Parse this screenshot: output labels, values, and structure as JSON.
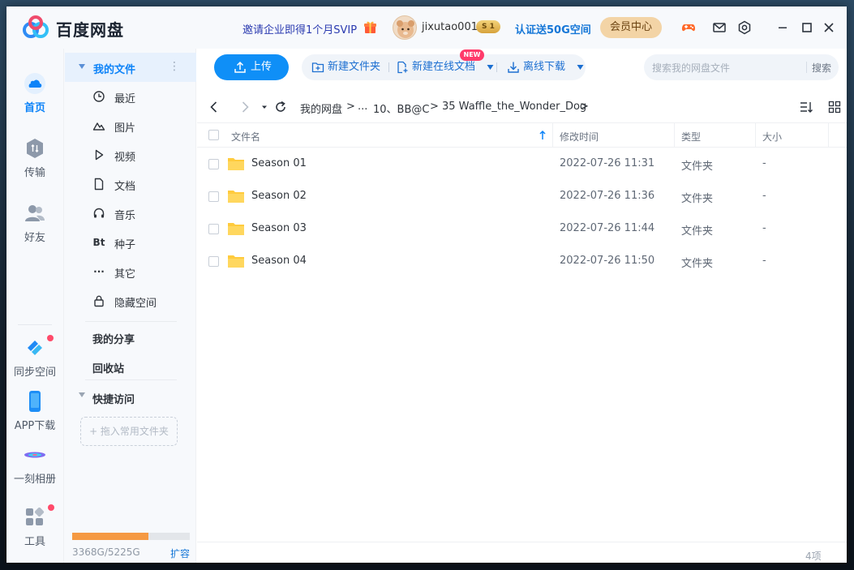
{
  "app": {
    "name": "百度网盘"
  },
  "titlebar": {
    "promo": "邀请企业即得1个月SVIP",
    "username": "jixutao001",
    "level_badge": "S 1",
    "verify": "认证送50G空间",
    "vip_center": "会员中心"
  },
  "leftnav": {
    "items": [
      {
        "label": "首页",
        "icon": "cloud-icon",
        "active": true
      },
      {
        "label": "传输",
        "icon": "transfer-icon"
      },
      {
        "label": "好友",
        "icon": "friends-icon"
      },
      {
        "label": "同步空间",
        "icon": "sync-space-icon"
      },
      {
        "label": "APP下载",
        "icon": "phone-icon"
      },
      {
        "label": "一刻相册",
        "icon": "album-icon"
      },
      {
        "label": "工具",
        "icon": "tools-icon"
      }
    ]
  },
  "sidepanel": {
    "my_files": "我的文件",
    "more": "⋮",
    "categories": [
      {
        "label": "最近",
        "icon": "clock-icon"
      },
      {
        "label": "图片",
        "icon": "image-icon"
      },
      {
        "label": "视频",
        "icon": "play-icon"
      },
      {
        "label": "文档",
        "icon": "document-icon"
      },
      {
        "label": "音乐",
        "icon": "headphones-icon"
      },
      {
        "label": "种子",
        "icon": "bt-icon",
        "glyph": "Bt"
      },
      {
        "label": "其它",
        "icon": "more-dots-icon",
        "glyph": "···"
      },
      {
        "label": "隐藏空间",
        "icon": "lock-icon"
      }
    ],
    "my_share": "我的分享",
    "recycle_bin": "回收站",
    "quick_access": "快捷访问",
    "drop_hint": "+ 拖入常用文件夹",
    "quota": {
      "text": "3368G/5225G",
      "used": 3368,
      "total": 5225
    },
    "expand": "扩容"
  },
  "toolbar": {
    "upload": "上传",
    "new_folder": "新建文件夹",
    "new_online_doc": "新建在线文档",
    "new_badge": "NEW",
    "offline_download": "离线下载",
    "search_placeholder": "搜索我的网盘文件",
    "search_button": "搜索"
  },
  "breadcrumb": {
    "items": [
      "我的网盘",
      "...",
      "10、BB@C",
      "35 Waffle_the_Wonder_Dog"
    ],
    "separator": ">"
  },
  "table": {
    "headers": {
      "name": "文件名",
      "modified": "修改时间",
      "type": "类型",
      "size": "大小"
    },
    "rows": [
      {
        "name": "Season 01",
        "modified": "2022-07-26 11:31",
        "type": "文件夹",
        "size": "-"
      },
      {
        "name": "Season 02",
        "modified": "2022-07-26 11:36",
        "type": "文件夹",
        "size": "-"
      },
      {
        "name": "Season 03",
        "modified": "2022-07-26 11:44",
        "type": "文件夹",
        "size": "-"
      },
      {
        "name": "Season 04",
        "modified": "2022-07-26 11:50",
        "type": "文件夹",
        "size": "-"
      }
    ]
  },
  "footer": {
    "count": "4项"
  },
  "colors": {
    "accent": "#0f8ff7",
    "folder": "#ffcb3d",
    "quota": "#f59a42",
    "vip": "#f3d4a6"
  }
}
